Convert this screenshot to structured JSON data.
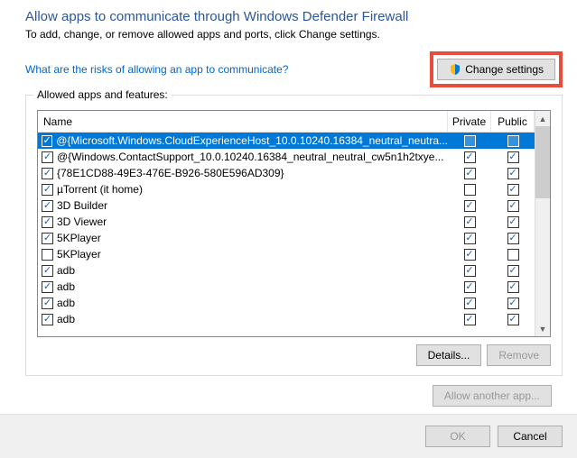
{
  "title": "Allow apps to communicate through Windows Defender Firewall",
  "subtitle": "To add, change, or remove allowed apps and ports, click Change settings.",
  "risk_link": "What are the risks of allowing an app to communicate?",
  "change_settings": "Change settings",
  "group_label": "Allowed apps and features:",
  "cols": {
    "name": "Name",
    "private": "Private",
    "public": "Public"
  },
  "rows": [
    {
      "enabled": true,
      "name": "@{Microsoft.Windows.CloudExperienceHost_10.0.10240.16384_neutral_neutra...",
      "private": false,
      "public": false,
      "selected": true
    },
    {
      "enabled": true,
      "name": "@{Windows.ContactSupport_10.0.10240.16384_neutral_neutral_cw5n1h2txye...",
      "private": true,
      "public": true
    },
    {
      "enabled": true,
      "name": "{78E1CD88-49E3-476E-B926-580E596AD309}",
      "private": true,
      "public": true
    },
    {
      "enabled": true,
      "name": "µTorrent (it home)",
      "private": false,
      "public": true
    },
    {
      "enabled": true,
      "name": "3D Builder",
      "private": true,
      "public": true
    },
    {
      "enabled": true,
      "name": "3D Viewer",
      "private": true,
      "public": true
    },
    {
      "enabled": true,
      "name": "5KPlayer",
      "private": true,
      "public": true
    },
    {
      "enabled": false,
      "name": "5KPlayer",
      "private": true,
      "public": false
    },
    {
      "enabled": true,
      "name": "adb",
      "private": true,
      "public": true
    },
    {
      "enabled": true,
      "name": "adb",
      "private": true,
      "public": true
    },
    {
      "enabled": true,
      "name": "adb",
      "private": true,
      "public": true
    },
    {
      "enabled": true,
      "name": "adb",
      "private": true,
      "public": true
    }
  ],
  "details": "Details...",
  "remove": "Remove",
  "allow_another": "Allow another app...",
  "ok": "OK",
  "cancel": "Cancel"
}
